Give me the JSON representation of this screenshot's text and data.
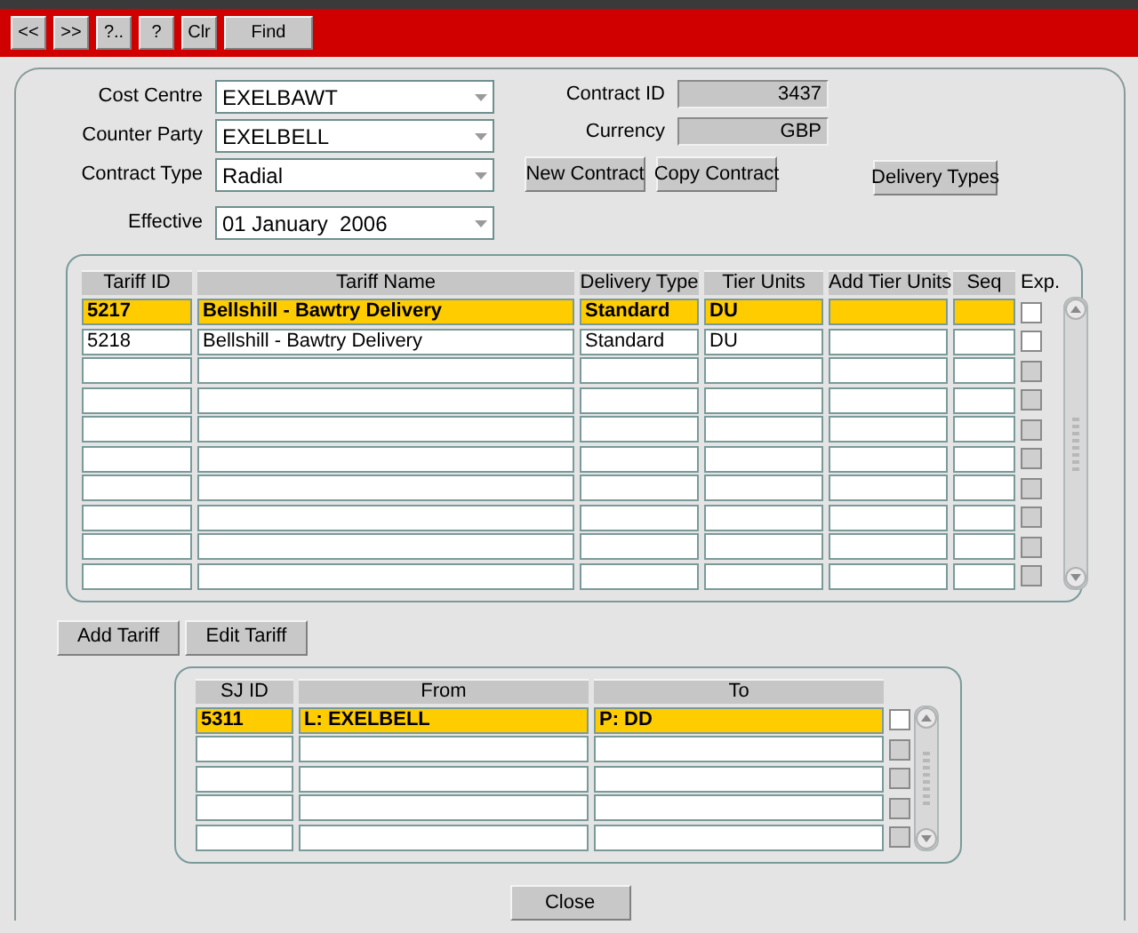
{
  "toolbar": {
    "buttons": [
      "<<",
      ">>",
      "?..",
      "?",
      "Clr",
      "Find"
    ]
  },
  "form": {
    "fields": [
      {
        "label": "Cost Centre",
        "value": "EXELBAWT"
      },
      {
        "label": "Counter Party",
        "value": "EXELBELL"
      },
      {
        "label": "Contract Type",
        "value": "Radial"
      },
      {
        "label": "Effective",
        "value": "01 January  2006"
      }
    ],
    "readonly_fields": [
      {
        "label": "Contract ID",
        "value": "3437"
      },
      {
        "label": "Currency",
        "value": "GBP"
      }
    ],
    "buttons": [
      "New Contract",
      "Copy Contract"
    ],
    "side_button": "Delivery Types"
  },
  "tariff_table": {
    "columns": [
      "Tariff ID",
      "Tariff Name",
      "Delivery Type",
      "Tier Units",
      "Add Tier Units",
      "Seq"
    ],
    "check_column": "Exp.",
    "rows": [
      {
        "cells": [
          "5217",
          "Bellshill - Bawtry Delivery",
          "Standard",
          "DU"
        ],
        "selected": true,
        "disabled": false,
        "checked": false
      },
      {
        "cells": [
          "5218",
          "Bellshill - Bawtry Delivery",
          "Standard",
          "DU"
        ],
        "selected": false,
        "disabled": false,
        "checked": false
      },
      {
        "selected": false,
        "disabled": true,
        "checked": false
      },
      {
        "selected": false,
        "disabled": true,
        "checked": false
      },
      {
        "selected": false,
        "disabled": true,
        "checked": false
      },
      {
        "selected": false,
        "disabled": true,
        "checked": false
      },
      {
        "selected": false,
        "disabled": true,
        "checked": false
      },
      {
        "selected": false,
        "disabled": true,
        "checked": false
      },
      {
        "selected": false,
        "disabled": true,
        "checked": false
      },
      {
        "selected": false,
        "disabled": true,
        "checked": false
      }
    ]
  },
  "tariff_buttons": [
    "Add Tariff",
    "Edit Tariff"
  ],
  "sj_table": {
    "columns": [
      "SJ ID",
      "From",
      "To"
    ],
    "rows": [
      {
        "cells": [
          "5311",
          "L: EXELBELL",
          "P: DD"
        ],
        "selected": true,
        "disabled": false,
        "checked": false
      },
      {
        "selected": false,
        "disabled": true,
        "checked": false
      },
      {
        "selected": false,
        "disabled": true,
        "checked": false
      },
      {
        "selected": false,
        "disabled": true,
        "checked": false
      },
      {
        "selected": false,
        "disabled": true,
        "checked": false
      }
    ]
  },
  "close_button": "Close"
}
